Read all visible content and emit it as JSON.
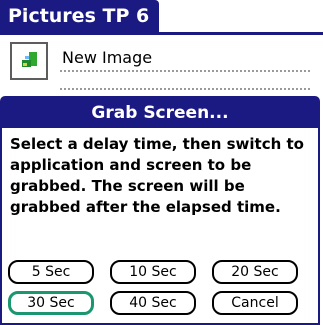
{
  "app": {
    "title": "Pictures TP 6"
  },
  "image_list": {
    "items": [
      {
        "name": "New Image",
        "thumbnail_icon": "image-thumbnail-icon"
      }
    ]
  },
  "dialog": {
    "title": "Grab Screen...",
    "message": "Select a delay time, then switch to application and screen to be grabbed.  The screen will be grabbed after the elapsed time.",
    "buttons": [
      {
        "label": "5 Sec",
        "selected": false
      },
      {
        "label": "10 Sec",
        "selected": false
      },
      {
        "label": "20 Sec",
        "selected": false
      },
      {
        "label": "30 Sec",
        "selected": true
      },
      {
        "label": "40 Sec",
        "selected": false
      },
      {
        "label": "Cancel",
        "selected": false
      }
    ]
  },
  "colors": {
    "title_bar": "#1b1a82",
    "selected_outline": "#1a9670"
  }
}
